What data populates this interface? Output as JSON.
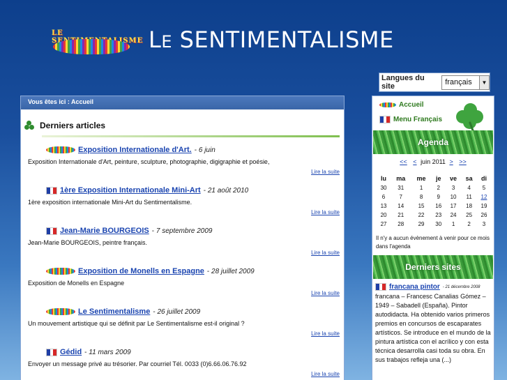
{
  "header": {
    "logo_text": "LE SENTIMENTALISME",
    "title_le": "L",
    "title_e": "E",
    "title_rest": "SENTIMENTALISME"
  },
  "lang": {
    "label": "Langues du site",
    "selected": "français",
    "arrow": "▼"
  },
  "breadcrumb": "Vous êtes ici : Accueil",
  "section": {
    "title": "Derniers articles"
  },
  "articles": [
    {
      "icon": "mini-logo",
      "title": "Exposition Internationale d'Art.",
      "date": "6 juin",
      "desc": "Exposition Internationale d'Art, peinture, sculpture, photographie, digigraphie et poésie,",
      "more": "Lire la suite"
    },
    {
      "icon": "french-flag",
      "title": "1ère Exposition Internationale Mini-Art",
      "date": "21 août 2010",
      "desc": "1ère exposition internationale Mini-Art du Sentimentalisme.",
      "more": "Lire la suite"
    },
    {
      "icon": "french-flag",
      "title": "Jean-Marie BOURGEOIS",
      "date": "7 septembre 2009",
      "desc": "Jean-Marie BOURGEOIS, peintre français.",
      "more": "Lire la suite"
    },
    {
      "icon": "mini-logo",
      "title": "Exposition de Monells en Espagne",
      "date": "28 juillet 2009",
      "desc": "Exposition de Monells en Espagne",
      "more": "Lire la suite"
    },
    {
      "icon": "mini-logo",
      "title": "Le Sentimentalisme",
      "date": "26 juillet 2009",
      "desc": "Un mouvement artistique qui se définit par Le Sentimentalisme est-il original ?",
      "more": "Lire la suite"
    },
    {
      "icon": "french-flag",
      "title": "Gédid",
      "date": "11 mars 2009",
      "desc": "Envoyer un message privé au trésorier. Par courriel Tél. 0033 (0)6.66.06.76.92",
      "more": "Lire la suite"
    }
  ],
  "sidebar": {
    "accueil": "Accueil",
    "menu_fr": "Menu Français",
    "agenda_title": "Agenda",
    "cal_nav": {
      "prev_year": "<<",
      "prev": "<",
      "month": "juin 2011",
      "next": ">",
      "next_year": ">>"
    },
    "days": [
      "lu",
      "ma",
      "me",
      "je",
      "ve",
      "sa",
      "di"
    ],
    "weeks": [
      [
        "30",
        "31",
        "1",
        "2",
        "3",
        "4",
        "5"
      ],
      [
        "6",
        "7",
        "8",
        "9",
        "10",
        "11",
        "12"
      ],
      [
        "13",
        "14",
        "15",
        "16",
        "17",
        "18",
        "19"
      ],
      [
        "20",
        "21",
        "22",
        "23",
        "24",
        "25",
        "26"
      ],
      [
        "27",
        "28",
        "29",
        "30",
        "1",
        "2",
        "3"
      ]
    ],
    "today": "12",
    "cal_note": "Il n'y a aucun évènement à venir pour ce mois dans l'agenda",
    "sites_title": "Derniers sites",
    "site": {
      "title": "francana pintor",
      "date": "21 décembre 2008",
      "desc": "francana – Francesc Canalias Gómez – 1949 – Sabadell (España). Pintor autodidacta. Ha obtenido varios primeros premios en concursos de escaparates artísticos. Se introduce en el mundo de la pintura artística con el acrílico y con esta técnica desarrolla casi toda su obra. En sus trabajos refleja una (...)"
    }
  },
  "colors": {
    "link": "#1a44b0",
    "green": "#2f7a1f",
    "bg_top": "#0d3f8c"
  }
}
